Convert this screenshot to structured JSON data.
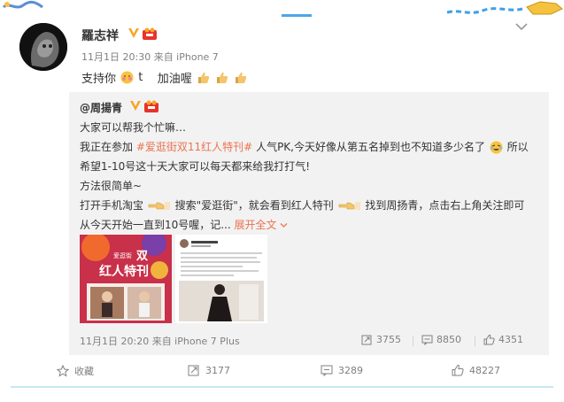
{
  "post": {
    "user_name": "羅志祥",
    "meta": "11月1日 20:30 来自 iPhone 7",
    "text_a": "支持你",
    "text_b": "t",
    "text_c": "加油喔"
  },
  "repost": {
    "user": "@周揚青",
    "line1": "大家可以帮我个忙嘛…",
    "line2_a": "我正在参加",
    "line2_link": "#爱逛街双11红人特刊#",
    "line2_b": "人气PK,今天好像从第五名掉到也不知道多少名了",
    "line2_c": "所以",
    "line3": "希望1-10号这十天大家可以每天都来给我打打气!",
    "line4": "方法很简单~",
    "line5_a": "打开手机淘宝",
    "line5_b": "搜索\"爱逛街\"，就会看到红人特刊",
    "line5_c": "找到周扬青，点击右上角关注即可",
    "line6_a": "从今天开始一直到10号喔，记...",
    "line6_expand": "展开全文",
    "thumb1_text_a": "爱逛街",
    "thumb1_text_b": "双",
    "thumb1_text_c": "红人特刊",
    "time": "11月1日 20:20 来自 iPhone 7 Plus",
    "reposts": "3755",
    "comments": "8850",
    "likes": "4351"
  },
  "actions": {
    "favorite": "收藏",
    "repost": "3177",
    "comment": "3289",
    "like": "48227"
  },
  "colors": {
    "link": "#eb7350",
    "meta": "#808080",
    "repost_bg": "#f2f2f2",
    "rule": "#c5e8f5",
    "vip": "#f5a623",
    "level": "#e8332a"
  },
  "icons": [
    "chevron-down-icon",
    "vip-icon",
    "level-icon",
    "shy-face-icon",
    "thumbs-up-icon",
    "laugh-cry-icon",
    "pointing-hand-icon",
    "repost-icon",
    "comment-icon",
    "like-icon",
    "star-icon"
  ]
}
